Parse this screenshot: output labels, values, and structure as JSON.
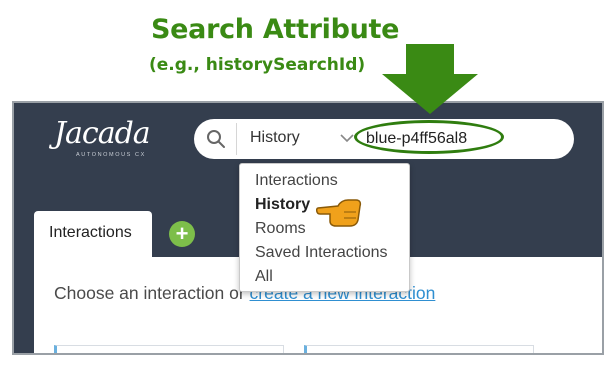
{
  "callout": {
    "title": "Search Attribute",
    "subtitle": "(e.g., historySearchId)"
  },
  "header": {
    "logo_text": "Jacada",
    "logo_tagline": "AUTONOMOUS CX",
    "search": {
      "scope": "History",
      "query": "blue-p4ff56al8"
    }
  },
  "scope_dropdown": {
    "options": [
      "Interactions",
      "History",
      "Rooms",
      "Saved Interactions",
      "All"
    ],
    "selected": "History"
  },
  "tabs": {
    "active_label": "Interactions",
    "add_label": "+"
  },
  "main": {
    "prompt_prefix": "Choose an interaction or ",
    "prompt_link": "create a new interaction"
  },
  "colors": {
    "callout_green": "#3a8a14",
    "app_background": "#343e4e",
    "add_button": "#7dbe4a",
    "link": "#2f8fd1",
    "hand": "#f0a11b"
  },
  "icons": {
    "search": "search-icon",
    "chevron": "chevron-down-icon",
    "pointer": "pointing-hand-icon",
    "arrow": "down-arrow-icon"
  }
}
